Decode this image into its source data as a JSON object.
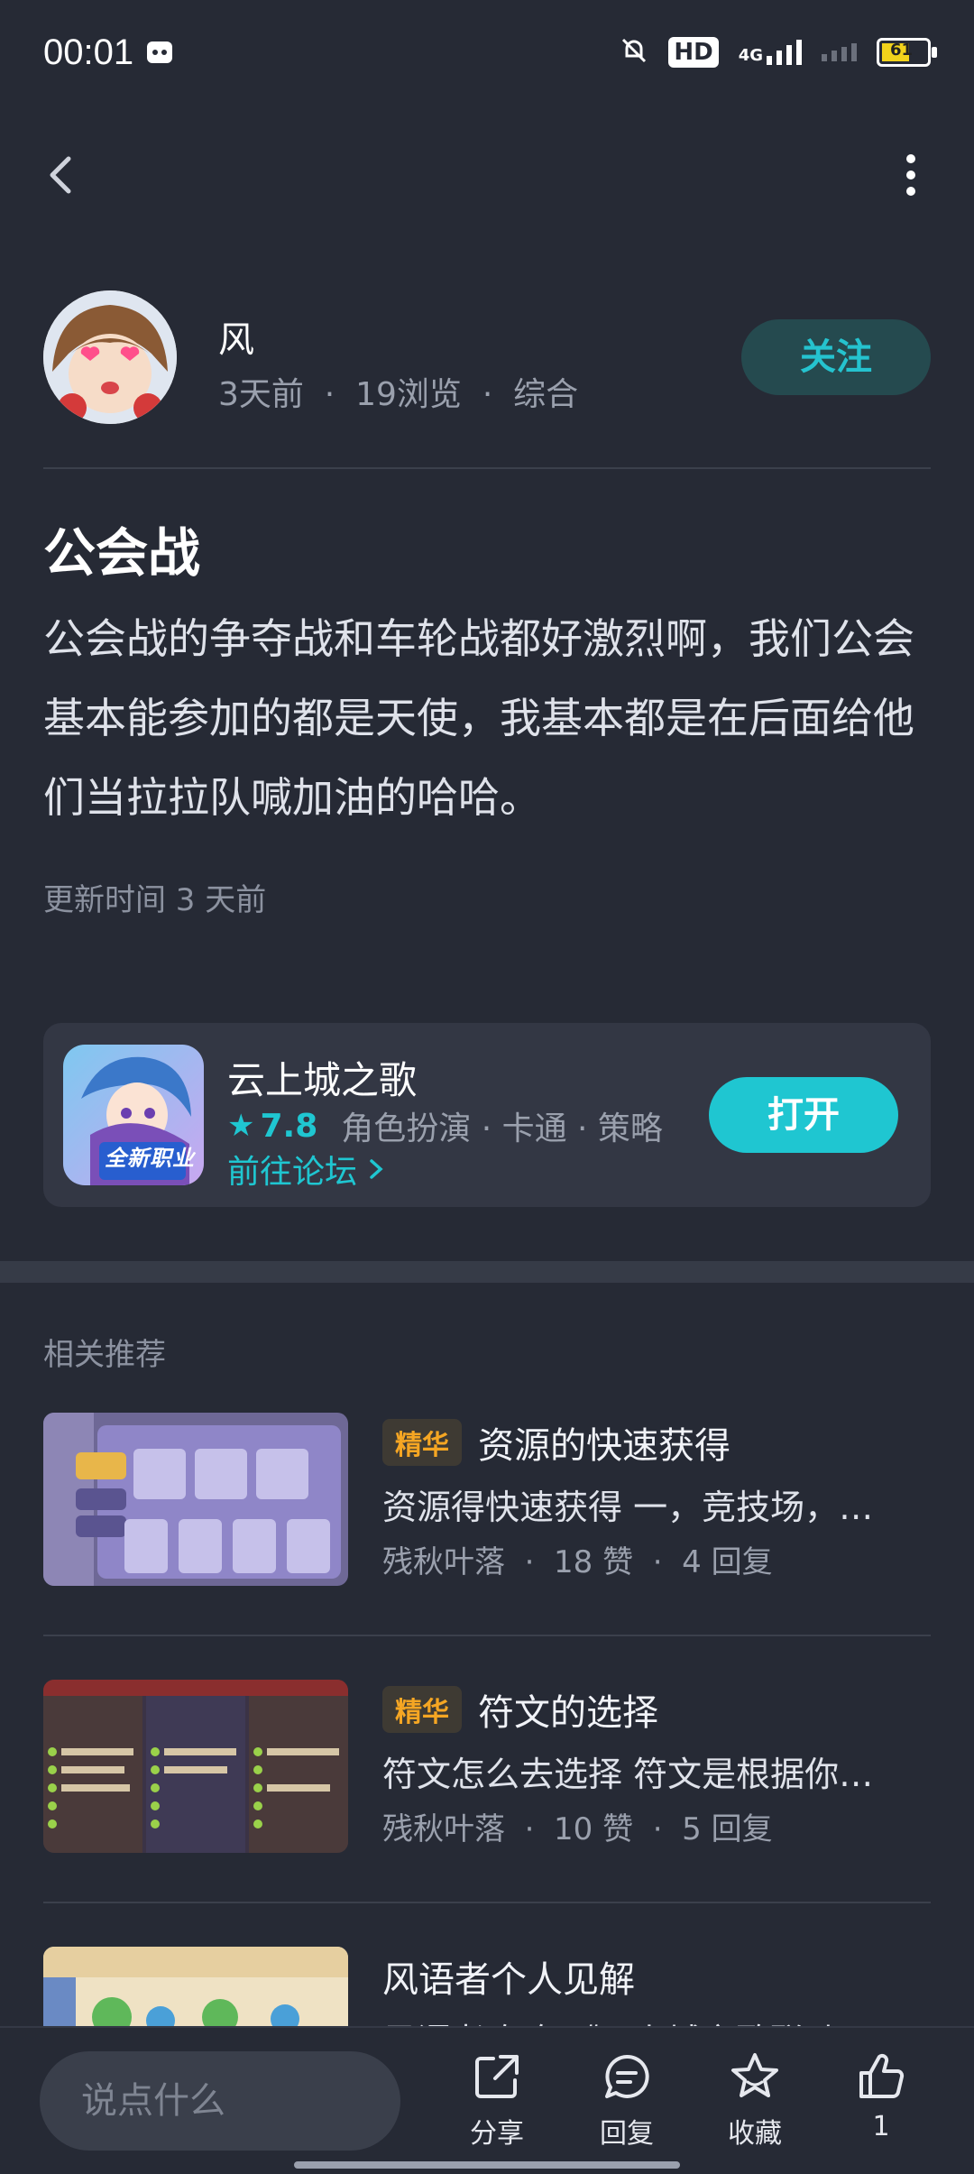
{
  "status_bar": {
    "time": "00:01",
    "network": "4G",
    "battery": "61"
  },
  "author": {
    "name": "风",
    "meta": "3天前  ·  19浏览  ·  综合",
    "follow_label": "关注"
  },
  "post": {
    "title": "公会战",
    "body": "公会战的争夺战和车轮战都好激烈啊，我们公会基本能参加的都是天使，我基本都是在后面给他们当拉拉队喊加油的哈哈。",
    "updated": "更新时间 3 天前"
  },
  "game": {
    "name": "云上城之歌",
    "score": "7.8",
    "tags": "角色扮演 · 卡通 · 策略",
    "forum_link": "前往论坛",
    "open_label": "打开",
    "icon_caption": "全新职业"
  },
  "related": {
    "title": "相关推荐",
    "items": [
      {
        "badge": "精华",
        "title": "资源的快速获得",
        "excerpt": "资源得快速获得 一，竞技场，…",
        "meta": "残秋叶落  ·  18 赞  ·  4 回复"
      },
      {
        "badge": "精华",
        "title": "符文的选择",
        "excerpt": "符文怎么去选择 符文是根据你…",
        "meta": "残秋叶落  ·  10 赞  ·  5 回复"
      },
      {
        "badge": "",
        "title": "风语者个人见解",
        "excerpt": "风语者攻略 《云上城之歌联动…",
        "meta": ""
      }
    ]
  },
  "bottom_bar": {
    "placeholder": "说点什么",
    "share": "分享",
    "reply": "回复",
    "favorite": "收藏",
    "likes": "1"
  },
  "colors": {
    "background": "#262a35",
    "accent": "#1fc6d1",
    "badge": "#f5a623"
  }
}
